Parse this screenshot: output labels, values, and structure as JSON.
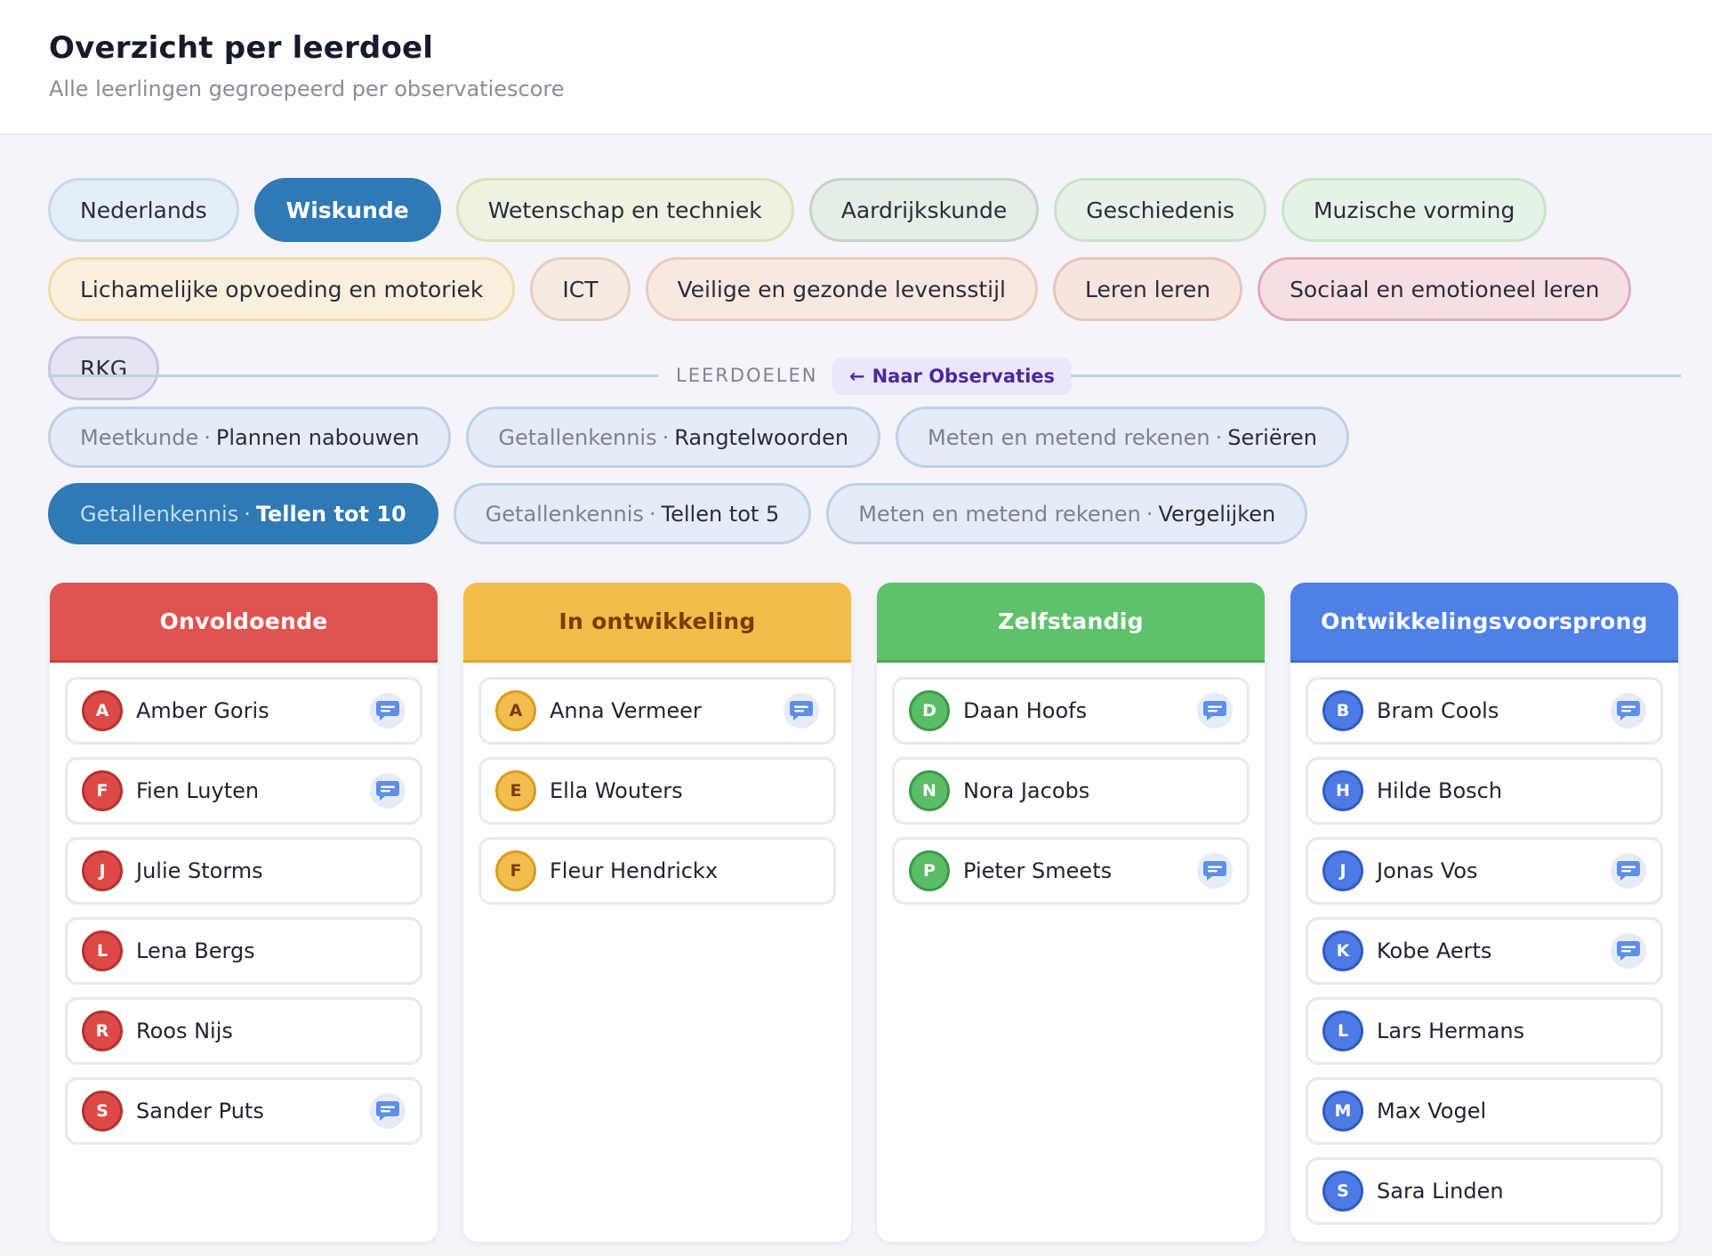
{
  "header": {
    "title": "Overzicht per leerdoel",
    "subtitle": "Alle leerlingen gegroepeerd per observatiescore"
  },
  "subjects": [
    {
      "label": "Nederlands",
      "bg": "#e3eef6",
      "border": "#c5d9e9",
      "active": false
    },
    {
      "label": "Wiskunde",
      "bg": "#2f79b4",
      "border": "#2f79b4",
      "active": true
    },
    {
      "label": "Wetenschap en techniek",
      "bg": "#eef2e0",
      "border": "#d8e3b5",
      "active": false
    },
    {
      "label": "Aardrijkskunde",
      "bg": "#e3eee4",
      "border": "#c3d5c6",
      "active": false
    },
    {
      "label": "Geschiedenis",
      "bg": "#e6f2e6",
      "border": "#c9e3c9",
      "active": false
    },
    {
      "label": "Muzische vorming",
      "bg": "#e4f3e5",
      "border": "#c6e6c8",
      "active": false
    },
    {
      "label": "Lichamelijke opvoeding en motoriek",
      "bg": "#faf0dc",
      "border": "#f0dcab",
      "active": false
    },
    {
      "label": "ICT",
      "bg": "#f5ebe0",
      "border": "#e6d0ba",
      "active": false
    },
    {
      "label": "Veilige en gezonde levensstijl",
      "bg": "#f8e8e0",
      "border": "#eccbbb",
      "active": false
    },
    {
      "label": "Leren leren",
      "bg": "#f7e4dd",
      "border": "#eac5b6",
      "active": false
    },
    {
      "label": "Sociaal en emotioneel leren",
      "bg": "#f6dfe3",
      "border": "#e6aab6",
      "active": false
    },
    {
      "label": "RKG",
      "bg": "#e5e4f2",
      "border": "#c8c5e2",
      "active": false
    }
  ],
  "goals_section": {
    "caption": "LEERDOELEN",
    "back_arrow": "←",
    "back_label": "Naar Observaties"
  },
  "goals": [
    {
      "domain": "Meetkunde",
      "sep": "·",
      "name": "Plannen nabouwen",
      "active": false
    },
    {
      "domain": "Getallenkennis",
      "sep": "·",
      "name": "Rangtelwoorden",
      "active": false
    },
    {
      "domain": "Meten en metend rekenen",
      "sep": "·",
      "name": "Seriëren",
      "active": false
    },
    {
      "domain": "Getallenkennis",
      "sep": "·",
      "name": "Tellen tot 10",
      "active": true
    },
    {
      "domain": "Getallenkennis",
      "sep": "·",
      "name": "Tellen tot 5",
      "active": false
    },
    {
      "domain": "Meten en metend rekenen",
      "sep": "·",
      "name": "Vergelijken",
      "active": false
    }
  ],
  "columns": [
    {
      "title": "Onvoldoende",
      "header_bg": "#de5450",
      "header_text": "#ffffff",
      "header_border": "#c8403c",
      "avatar_bg": "#dd4a46",
      "avatar_border": "#b53330",
      "students": [
        {
          "initial": "A",
          "name": "Amber Goris",
          "note": true
        },
        {
          "initial": "F",
          "name": "Fien Luyten",
          "note": true
        },
        {
          "initial": "J",
          "name": "Julie Storms",
          "note": false
        },
        {
          "initial": "L",
          "name": "Lena Bergs",
          "note": false
        },
        {
          "initial": "R",
          "name": "Roos Nijs",
          "note": false
        },
        {
          "initial": "S",
          "name": "Sander Puts",
          "note": true
        }
      ]
    },
    {
      "title": "In ontwikkeling",
      "header_bg": "#f1be47",
      "header_text": "#7a3d0a",
      "header_border": "#dea532",
      "avatar_bg": "#f2be4b",
      "avatar_border": "#d79e25",
      "avatar_text": "#7a3d0a",
      "students": [
        {
          "initial": "A",
          "name": "Anna Vermeer",
          "note": true
        },
        {
          "initial": "E",
          "name": "Ella Wouters",
          "note": false
        },
        {
          "initial": "F",
          "name": "Fleur Hendrickx",
          "note": false
        }
      ]
    },
    {
      "title": "Zelfstandig",
      "header_bg": "#5fc16a",
      "header_text": "#ffffff",
      "header_border": "#4aa956",
      "avatar_bg": "#5bbd67",
      "avatar_border": "#3f9a4b",
      "students": [
        {
          "initial": "D",
          "name": "Daan Hoofs",
          "note": true
        },
        {
          "initial": "N",
          "name": "Nora Jacobs",
          "note": false
        },
        {
          "initial": "P",
          "name": "Pieter Smeets",
          "note": true
        }
      ]
    },
    {
      "title": "Ontwikkelingsvoorsprong",
      "header_bg": "#4f80e6",
      "header_text": "#ffffff",
      "header_border": "#3c6ad1",
      "avatar_bg": "#4b7be3",
      "avatar_border": "#2f5cc0",
      "students": [
        {
          "initial": "B",
          "name": "Bram Cools",
          "note": true
        },
        {
          "initial": "H",
          "name": "Hilde Bosch",
          "note": false
        },
        {
          "initial": "J",
          "name": "Jonas Vos",
          "note": true
        },
        {
          "initial": "K",
          "name": "Kobe Aerts",
          "note": true
        },
        {
          "initial": "L",
          "name": "Lars Hermans",
          "note": false
        },
        {
          "initial": "M",
          "name": "Max Vogel",
          "note": false
        },
        {
          "initial": "S",
          "name": "Sara Linden",
          "note": false
        }
      ]
    }
  ],
  "icons": {
    "note": "comment-icon"
  }
}
